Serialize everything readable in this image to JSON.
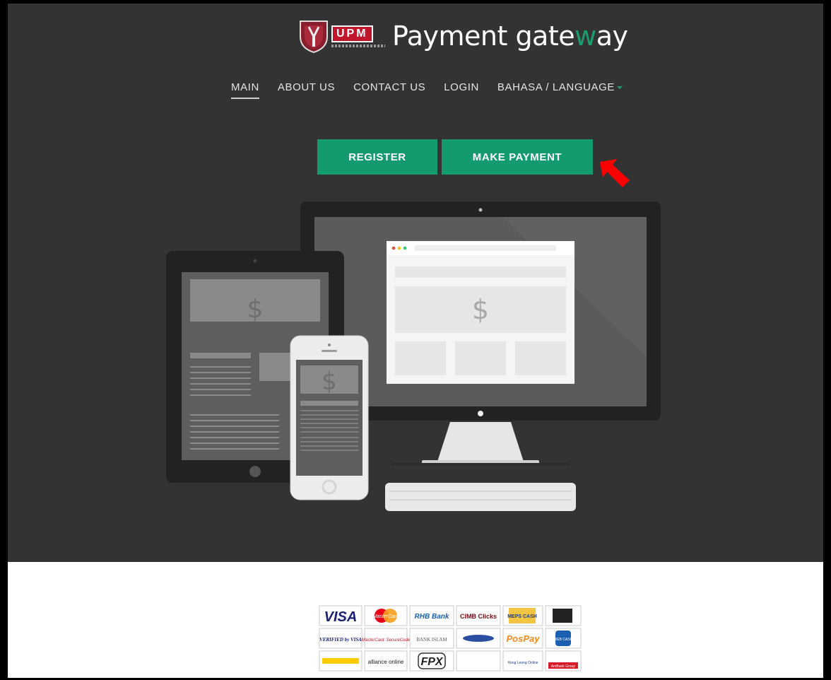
{
  "brand": {
    "badge": "UPM",
    "title_before": "Payment gate",
    "title_accent": "w",
    "title_after": "ay"
  },
  "nav": {
    "items": [
      {
        "label": "MAIN",
        "active": true
      },
      {
        "label": "ABOUT US",
        "active": false
      },
      {
        "label": "CONTACT US",
        "active": false
      },
      {
        "label": "LOGIN",
        "active": false
      },
      {
        "label": "BAHASA / LANGUAGE",
        "active": false,
        "dropdown": true
      }
    ]
  },
  "actions": {
    "register_label": "REGISTER",
    "payment_label": "MAKE PAYMENT"
  },
  "illustration": {
    "currency_symbol": "$"
  },
  "payment_logos": {
    "row1": [
      "VISA",
      "MasterCard",
      "RHB Bank",
      "CIMB Clicks",
      "MEPS CASH",
      ""
    ],
    "row2": [
      "VERIFIED by VISA",
      "MasterCard. SecureCode",
      "BANK ISLAM",
      "",
      "PosPay",
      "WEB CASH"
    ],
    "row3": [
      "",
      "alliance online",
      "FPX",
      "",
      "Hong Leong Online",
      "AmBank Group"
    ]
  },
  "colors": {
    "hero_bg": "#333333",
    "accent": "#139b6f",
    "brand_red": "#c0162b",
    "arrow": "#ff0000"
  }
}
